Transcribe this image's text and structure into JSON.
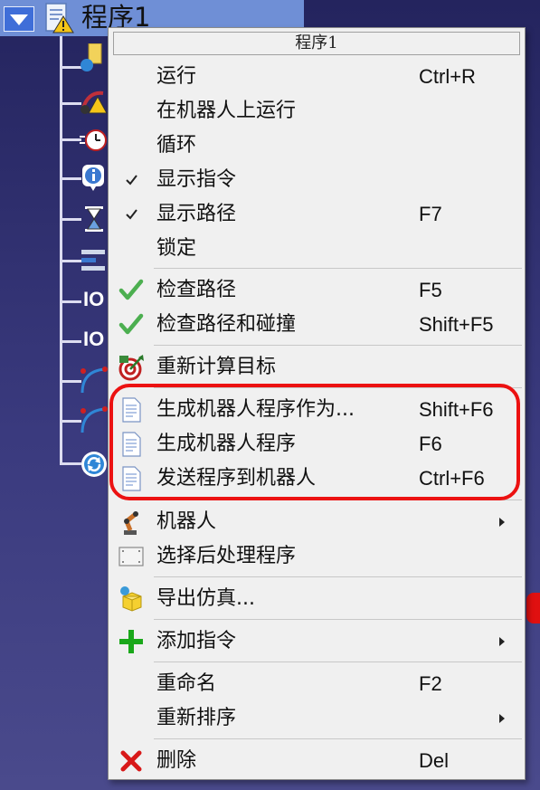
{
  "tree": {
    "title": "程序1",
    "io_label": "IO"
  },
  "menu": {
    "title": "程序1",
    "items": [
      {
        "label": "运行",
        "shortcut": "Ctrl+R"
      },
      {
        "label": "在机器人上运行",
        "shortcut": ""
      },
      {
        "label": "循环",
        "shortcut": ""
      },
      {
        "label": "显示指令",
        "shortcut": "",
        "checked": true
      },
      {
        "label": "显示路径",
        "shortcut": "F7",
        "checked": true
      },
      {
        "label": "锁定",
        "shortcut": ""
      },
      {
        "label": "检查路径",
        "shortcut": "F5",
        "icon": "green-check-icon"
      },
      {
        "label": "检查路径和碰撞",
        "shortcut": "Shift+F5",
        "icon": "green-check-icon"
      },
      {
        "label": "重新计算目标",
        "shortcut": "",
        "icon": "recalculate-target-icon"
      },
      {
        "label": "生成机器人程序作为...",
        "shortcut": "Shift+F6",
        "icon": "document-icon"
      },
      {
        "label": "生成机器人程序",
        "shortcut": "F6",
        "icon": "document-icon"
      },
      {
        "label": "发送程序到机器人",
        "shortcut": "Ctrl+F6",
        "icon": "document-icon"
      },
      {
        "label": "机器人",
        "shortcut": "",
        "icon": "robot-arm-icon",
        "submenu": true
      },
      {
        "label": "选择后处理程序",
        "shortcut": "",
        "icon": "post-processor-icon"
      },
      {
        "label": "导出仿真...",
        "shortcut": "",
        "icon": "export-box-icon"
      },
      {
        "label": "添加指令",
        "shortcut": "",
        "icon": "green-plus-icon",
        "submenu": true
      },
      {
        "label": "重命名",
        "shortcut": "F2"
      },
      {
        "label": "重新排序",
        "shortcut": "",
        "submenu": true
      },
      {
        "label": "删除",
        "shortcut": "Del",
        "icon": "red-x-icon"
      }
    ]
  },
  "colors": {
    "highlight": "#ec1212",
    "menu_bg": "#f0f0f0",
    "check_green": "#4caf50"
  }
}
